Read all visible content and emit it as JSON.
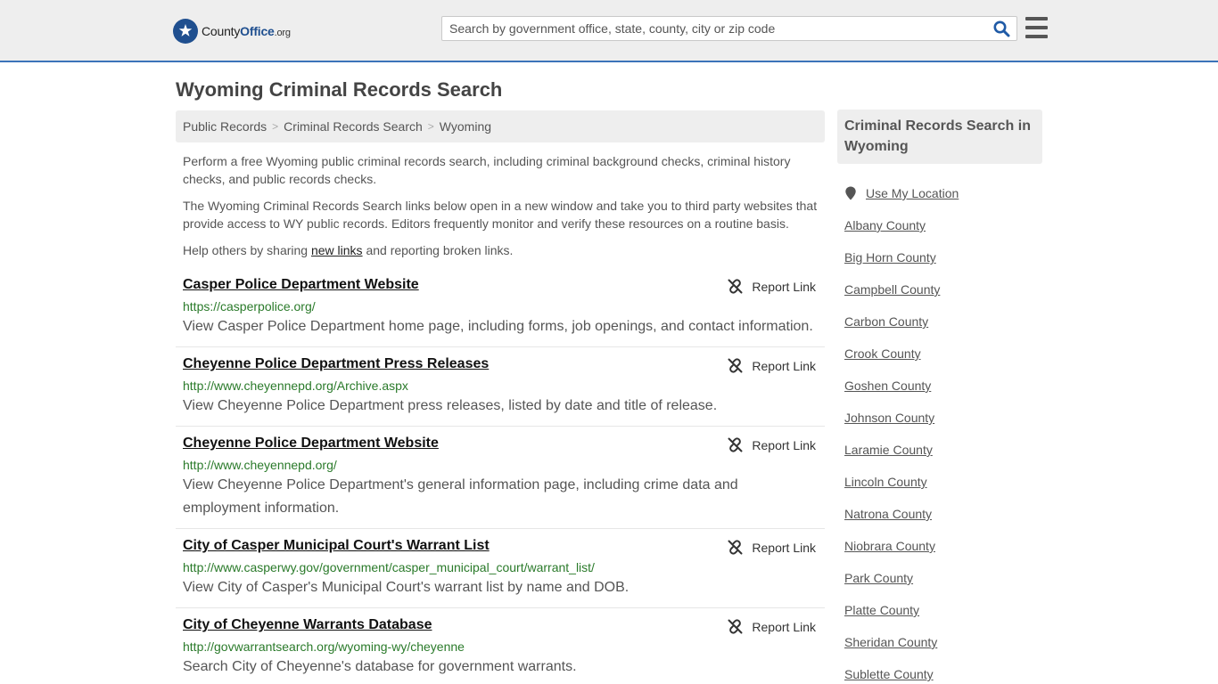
{
  "header": {
    "logo": {
      "name_part1": "County",
      "name_part2": "Office",
      "tld": ".org"
    },
    "search": {
      "placeholder": "Search by government office, state, county, city or zip code",
      "value": ""
    },
    "icons": {
      "search": "search-icon",
      "menu": "hamburger-menu-icon",
      "logo": "star-badge-icon"
    },
    "accent_color": "#3b73b9"
  },
  "page": {
    "title": "Wyoming Criminal Records Search"
  },
  "breadcrumb": [
    {
      "label": "Public Records"
    },
    {
      "label": "Criminal Records Search"
    },
    {
      "label": "Wyoming"
    }
  ],
  "intro": {
    "p1": "Perform a free Wyoming public criminal records search, including criminal background checks, criminal history checks, and public records checks.",
    "p2": "The Wyoming Criminal Records Search links below open in a new window and take you to third party websites that provide access to WY public records. Editors frequently monitor and verify these resources on a routine basis.",
    "p3_before": "Help others by sharing ",
    "p3_link": "new links",
    "p3_after": " and reporting broken links."
  },
  "report_label": "Report Link",
  "results": [
    {
      "title": "Casper Police Department Website",
      "url": "https://casperpolice.org/",
      "desc": "View Casper Police Department home page, including forms, job openings, and contact information."
    },
    {
      "title": "Cheyenne Police Department Press Releases",
      "url": "http://www.cheyennepd.org/Archive.aspx",
      "desc": "View Cheyenne Police Department press releases, listed by date and title of release."
    },
    {
      "title": "Cheyenne Police Department Website",
      "url": "http://www.cheyennepd.org/",
      "desc": "View Cheyenne Police Department's general information page, including crime data and employment information."
    },
    {
      "title": "City of Casper Municipal Court's Warrant List",
      "url": "http://www.casperwy.gov/government/casper_municipal_court/warrant_list/",
      "desc": "View City of Casper's Municipal Court's warrant list by name and DOB."
    },
    {
      "title": "City of Cheyenne Warrants Database",
      "url": "http://govwarrantsearch.org/wyoming-wy/cheyenne",
      "desc": "Search City of Cheyenne's database for government warrants."
    }
  ],
  "sidebar": {
    "heading": "Criminal Records Search in Wyoming",
    "use_location": "Use My Location",
    "counties": [
      "Albany County",
      "Big Horn County",
      "Campbell County",
      "Carbon County",
      "Crook County",
      "Goshen County",
      "Johnson County",
      "Laramie County",
      "Lincoln County",
      "Natrona County",
      "Niobrara County",
      "Park County",
      "Platte County",
      "Sheridan County",
      "Sublette County"
    ]
  }
}
